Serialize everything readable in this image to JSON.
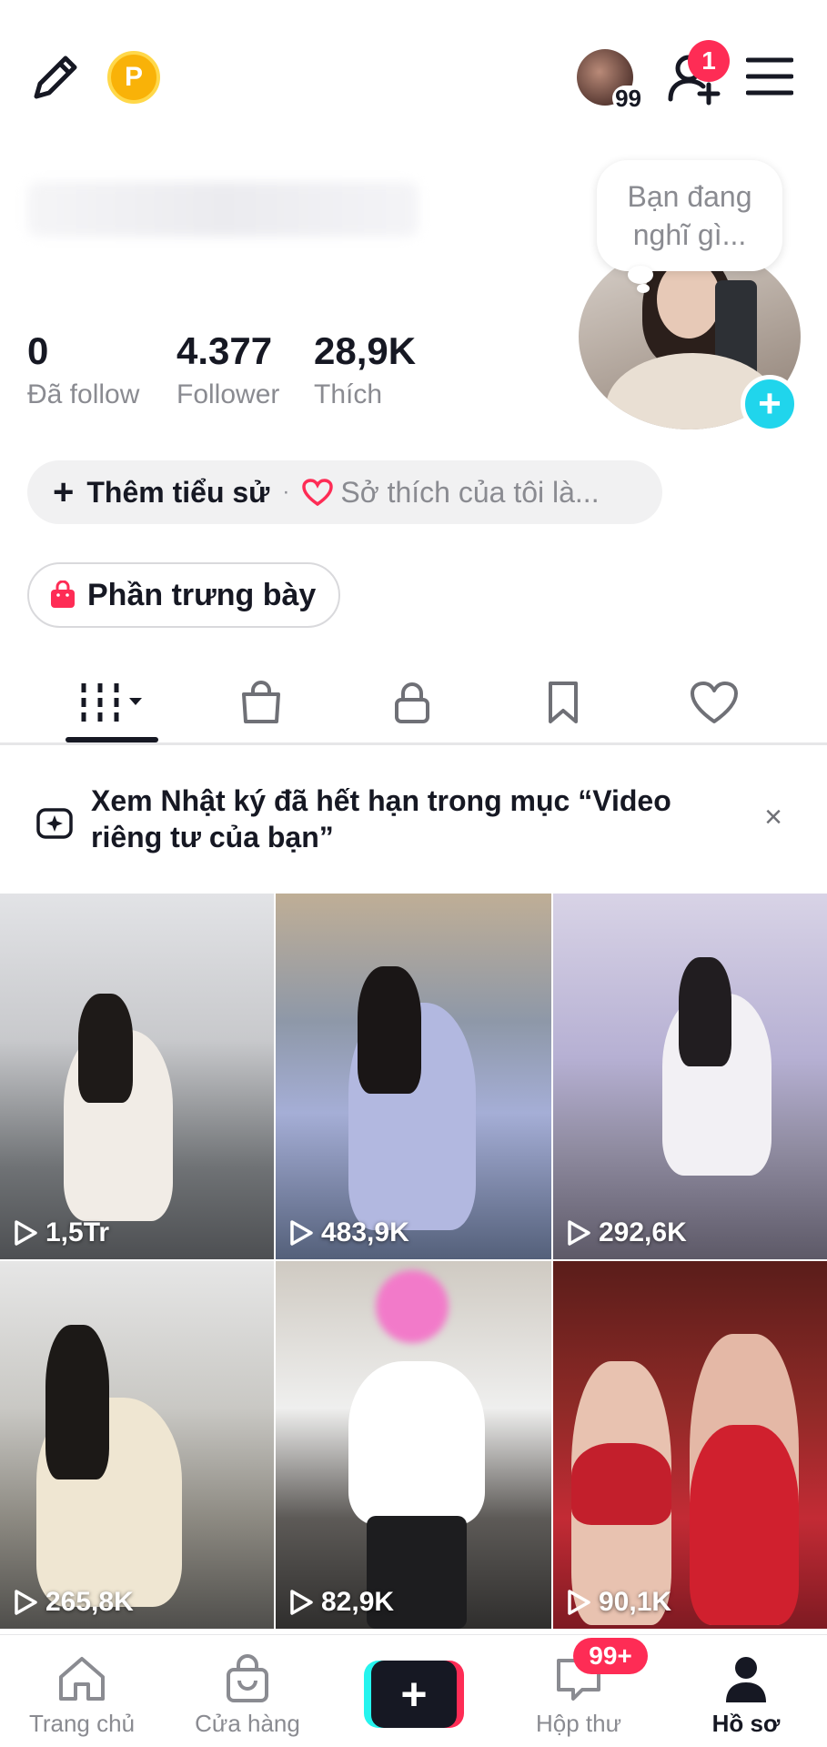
{
  "header": {
    "story_count": "99",
    "notification_count": "1",
    "coin_letter": "P"
  },
  "profile": {
    "thought_bubble": "Bạn đang nghĩ gì...",
    "stats": [
      {
        "value": "0",
        "label": "Đã follow"
      },
      {
        "value": "4.377",
        "label": "Follower"
      },
      {
        "value": "28,9K",
        "label": "Thích"
      }
    ],
    "bio_add_label": "Thêm tiểu sử",
    "bio_separator": "·",
    "bio_interest_placeholder": "Sở thích của tôi là...",
    "showcase_label": "Phần trưng bày"
  },
  "tabs": [
    {
      "name": "videos",
      "icon": "grid-icon",
      "selected": true
    },
    {
      "name": "shop",
      "icon": "shopping-bag-icon"
    },
    {
      "name": "private",
      "icon": "lock-icon"
    },
    {
      "name": "saved",
      "icon": "bookmark-icon"
    },
    {
      "name": "liked",
      "icon": "heart-icon"
    }
  ],
  "banner": {
    "text": "Xem Nhật ký đã hết hạn trong mục “Video riêng tư của bạn”",
    "close": "×"
  },
  "videos": [
    {
      "views": "1,5Tr"
    },
    {
      "views": "483,9K"
    },
    {
      "views": "292,6K"
    },
    {
      "views": "265,8K"
    },
    {
      "views": "82,9K"
    },
    {
      "views": "90,1K"
    }
  ],
  "bottom_nav": {
    "home": "Trang chủ",
    "shop": "Cửa hàng",
    "create": "+",
    "inbox": "Hộp thư",
    "inbox_badge": "99+",
    "profile": "Hồ sơ"
  },
  "colors": {
    "accent_red": "#fe2c55",
    "accent_cyan": "#25f4ee",
    "add_blue": "#20d5ec",
    "coin_yellow": "#f9b208"
  }
}
